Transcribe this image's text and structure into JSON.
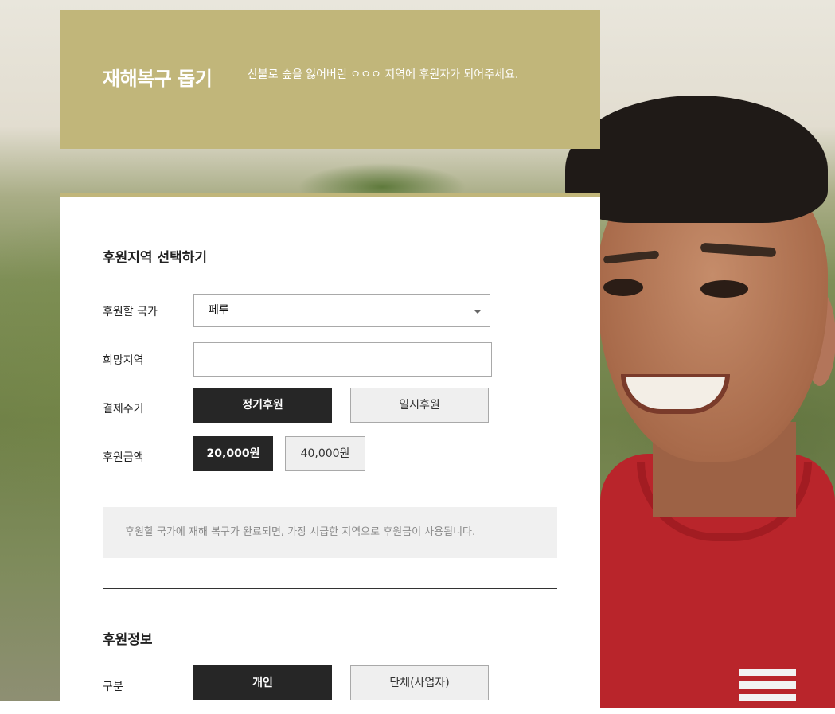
{
  "header": {
    "title": "재해복구 돕기",
    "subtitle": "산불로 숲을 잃어버린 ㅇㅇㅇ 지역에 후원자가 되어주세요."
  },
  "region_section": {
    "title": "후원지역 선택하기",
    "country_label": "후원할 국가",
    "country_value": "페루",
    "region_label": "희망지역",
    "region_value": "",
    "cycle_label": "결제주기",
    "cycle_options": [
      "정기후원",
      "일시후원"
    ],
    "cycle_selected": "정기후원",
    "amount_label": "후원금액",
    "amount_options": [
      "20,000원",
      "40,000원"
    ],
    "amount_selected": "20,000원",
    "notice": "후원할 국가에 재해 복구가 완료되면, 가장 시급한 지역으로 후원금이 사용됩니다."
  },
  "info_section": {
    "title": "후원정보",
    "type_label": "구분",
    "type_options": [
      "개인",
      "단체(사업자)"
    ],
    "type_selected": "개인"
  },
  "colors": {
    "accent": "#c1b67a",
    "dark_button": "#262626",
    "light_button": "#efefef",
    "notice_bg": "#f0f0f0"
  }
}
